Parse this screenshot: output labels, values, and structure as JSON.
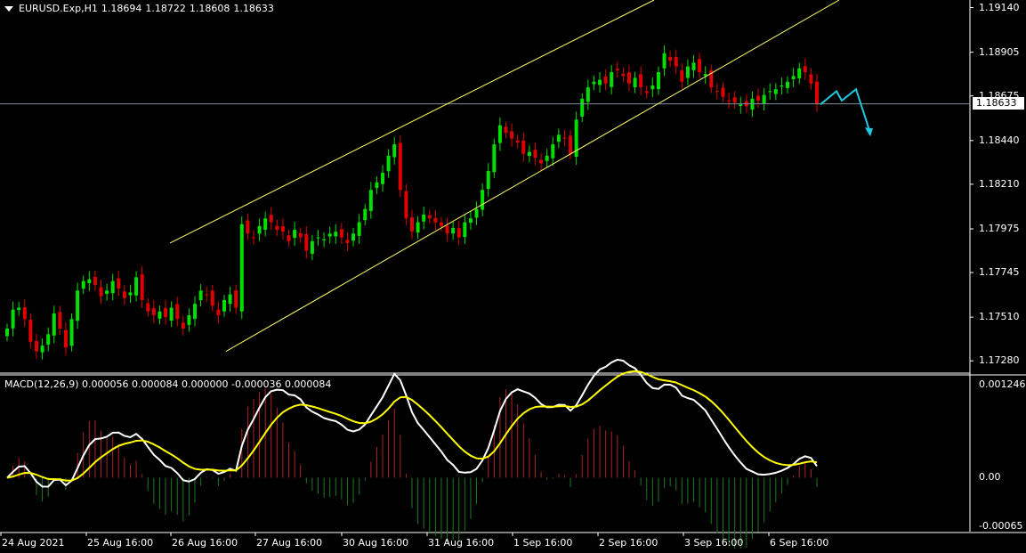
{
  "header": {
    "symbol": "EURUSD.Exp,H1",
    "open": "1.18694",
    "high": "1.18722",
    "low": "1.18608",
    "close": "1.18633"
  },
  "macd_header": "MACD(12,26,9) 0.000056 0.000084 0.000000 -0.000036 0.000084",
  "current_price": "1.18633",
  "colors": {
    "background": "#000000",
    "bull": "#00e000",
    "bear": "#e00000",
    "channel": "#ffff66",
    "price_line": "#7f8ea0",
    "macd_line": "#ffffff",
    "signal_line": "#ffff00",
    "hist_pos": "#b22222",
    "hist_neg": "#1f7a1f",
    "arrow": "#20c8e0"
  },
  "chart_data": [
    {
      "type": "candlestick",
      "title": "EURUSD.Exp,H1",
      "y_ticks": [
        "1.19140",
        "1.18905",
        "1.18675",
        "1.18440",
        "1.18210",
        "1.17975",
        "1.17745",
        "1.17510",
        "1.17280"
      ],
      "ylim": [
        1.1722,
        1.1918
      ],
      "x_ticks": [
        "24 Aug 2021",
        "25 Aug 16:00",
        "26 Aug 16:00",
        "27 Aug 16:00",
        "30 Aug 16:00",
        "31 Aug 16:00",
        "1 Sep 16:00",
        "2 Sep 16:00",
        "3 Sep 16:00",
        "6 Sep 16:00"
      ],
      "close_path": [
        1.1745,
        1.1755,
        1.1756,
        1.175,
        1.1738,
        1.1733,
        1.1736,
        1.1742,
        1.1753,
        1.1745,
        1.1735,
        1.175,
        1.1765,
        1.177,
        1.1771,
        1.1768,
        1.1762,
        1.1765,
        1.177,
        1.1766,
        1.1761,
        1.1764,
        1.1772,
        1.176,
        1.1754,
        1.1752,
        1.1754,
        1.1751,
        1.1756,
        1.175,
        1.1745,
        1.1752,
        1.1758,
        1.1765,
        1.1763,
        1.1757,
        1.1752,
        1.176,
        1.1763,
        1.1756,
        1.18,
        1.1795,
        1.1793,
        1.1799,
        1.1803,
        1.1801,
        1.1797,
        1.1796,
        1.1791,
        1.1797,
        1.1793,
        1.1786,
        1.1791,
        1.1793,
        1.1792,
        1.1795,
        1.1796,
        1.1793,
        1.179,
        1.1795,
        1.1801,
        1.1808,
        1.1818,
        1.1822,
        1.1827,
        1.1836,
        1.1842,
        1.1818,
        1.1803,
        1.1796,
        1.1801,
        1.1805,
        1.1803,
        1.1801,
        1.1799,
        1.1795,
        1.1798,
        1.1793,
        1.1801,
        1.1803,
        1.1808,
        1.1818,
        1.1828,
        1.1842,
        1.1852,
        1.1848,
        1.1845,
        1.1843,
        1.1837,
        1.1838,
        1.1835,
        1.1832,
        1.1836,
        1.1842,
        1.1847,
        1.1845,
        1.1837,
        1.1855,
        1.1866,
        1.1872,
        1.1875,
        1.1876,
        1.1874,
        1.188,
        1.1881,
        1.1878,
        1.1874,
        1.1877,
        1.1872,
        1.1869,
        1.1873,
        1.188,
        1.189,
        1.1886,
        1.1883,
        1.1875,
        1.1883,
        1.1885,
        1.188,
        1.1879,
        1.1872,
        1.187,
        1.1867,
        1.1865,
        1.1864,
        1.1863,
        1.1862,
        1.1866,
        1.1865,
        1.1868,
        1.187,
        1.1871,
        1.1873,
        1.1875,
        1.1878,
        1.1882,
        1.188,
        1.1874,
        1.1863
      ],
      "channel_upper": {
        "start": [
          "26 Aug 16:00",
          1.179
        ],
        "end": [
          "3 Sep 08:00",
          1.1918
        ]
      },
      "channel_middle": {
        "start": [
          "27 Aug 08:00",
          1.1733
        ],
        "end": [
          "7 Sep 12:00",
          1.1918
        ]
      },
      "horizontal_line": 1.18633,
      "forecast_arrow": [
        1.1863,
        1.187,
        1.1865,
        1.1871,
        1.1848
      ]
    },
    {
      "type": "macd",
      "title": "MACD(12,26,9)",
      "values": {
        "macd": 5.6e-05,
        "signal": 8.4e-05
      },
      "y_ticks": [
        "0.001246",
        "0.00",
        "-0.00065"
      ],
      "ylim": [
        -0.00065,
        0.001246
      ]
    }
  ]
}
